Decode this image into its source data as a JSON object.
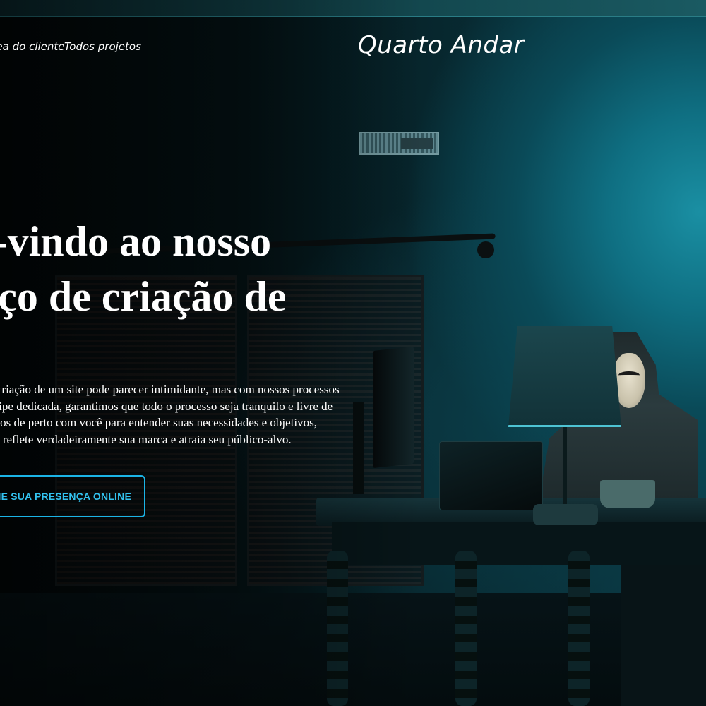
{
  "nav": {
    "links": [
      {
        "label": "Área do cliente"
      },
      {
        "label": "Todos projetos"
      }
    ],
    "logo": "Quarto Andar"
  },
  "hero": {
    "title": "Bem-vindo ao nosso serviço de criação de sites!",
    "description": "Entendemos que a criação de um site pode parecer intimidante, mas com nossos processos simplificados e equipe dedicada, garantimos que todo o processo seja tranquilo e livre de estresse. Trabalhamos de perto com você para entender suas necessidades e objetivos, criando um site que reflete verdadeiramente sua marca e atraia seu público-alvo.",
    "cta_label": "IMPULSIONE SUA PRESENÇA ONLINE"
  },
  "colors": {
    "accent": "#1bb4e6",
    "text": "#ffffff",
    "background": "#041215"
  }
}
